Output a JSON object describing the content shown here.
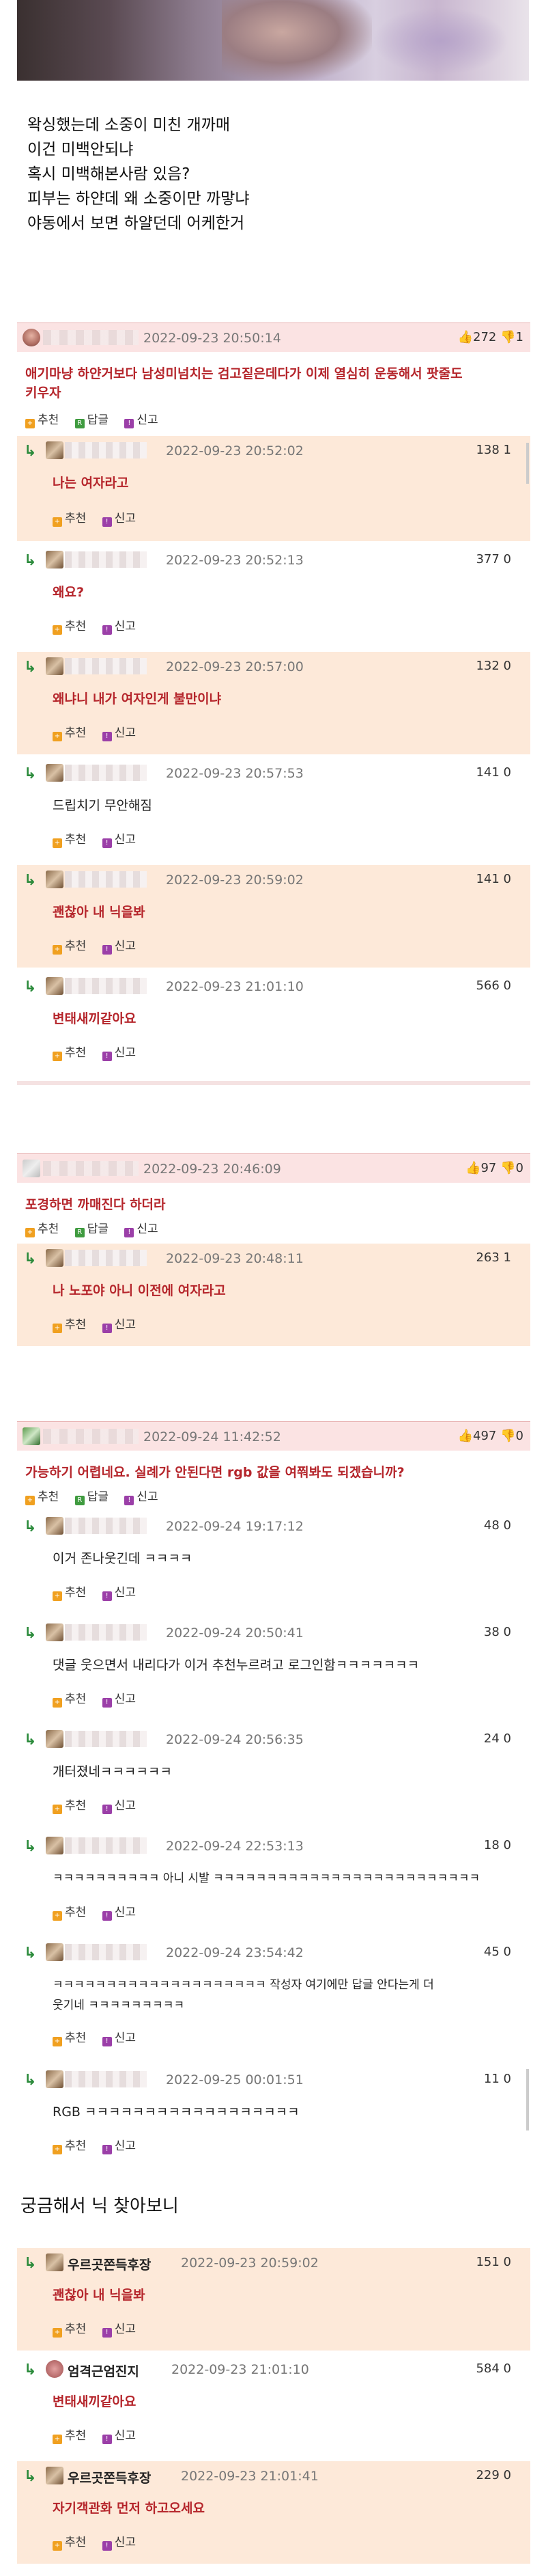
{
  "post": {
    "lines": [
      "왁싱했는데 소중이 미친 개까매",
      "이건 미백안되냐",
      "혹시 미백해본사람 있음?",
      "피부는 하얀데 왜 소중이만 까맣냐",
      "야동에서 보면 하얄던데 어케한거"
    ]
  },
  "actions": {
    "recommend": "추천",
    "reply": "답글",
    "report": "신고"
  },
  "thread1": {
    "date": "2022-09-23 20:50:14",
    "up": "272",
    "down": "1",
    "text1": "애기마냥 하얀거보다 남성미넘치는 검고짙은데다가 이제 열심히 운동해서 팟줄도",
    "text2": "키우자",
    "replies": [
      {
        "date": "2022-09-23 20:52:02",
        "up": "138",
        "down": "1",
        "text": "나는 여자라고"
      },
      {
        "date": "2022-09-23 20:52:13",
        "up": "377",
        "down": "0",
        "text": "왜요?"
      },
      {
        "date": "2022-09-23 20:57:00",
        "up": "132",
        "down": "0",
        "text": "왜냐니 내가 여자인게 불만이냐"
      },
      {
        "date": "2022-09-23 20:57:53",
        "up": "141",
        "down": "0",
        "text": "드립치기 무안해짐"
      },
      {
        "date": "2022-09-23 20:59:02",
        "up": "141",
        "down": "0",
        "text": "괜찮아 내 닉을봐"
      },
      {
        "date": "2022-09-23 21:01:10",
        "up": "566",
        "down": "0",
        "text": "변태새끼같아요"
      }
    ]
  },
  "thread2": {
    "date": "2022-09-23 20:46:09",
    "up": "97",
    "down": "0",
    "text": "포경하면 까매진다 하더라",
    "reply": {
      "date": "2022-09-23 20:48:11",
      "up": "263",
      "down": "1",
      "text": "나 노포야 아니 이전에 여자라고"
    }
  },
  "thread3": {
    "date": "2022-09-24 11:42:52",
    "up": "497",
    "down": "0",
    "text": "가능하기 어렵네요. 실례가 안된다면 rgb 값을 여쭤봐도 되겠습니까?",
    "replies": [
      {
        "date": "2022-09-24 19:17:12",
        "up": "48",
        "down": "0",
        "text": "이거 존나웃긴데 ㅋㅋㅋㅋ"
      },
      {
        "date": "2022-09-24 20:50:41",
        "up": "38",
        "down": "0",
        "text": "댓글 웃으면서 내리다가 이거 추천누르려고 로그인함ㅋㅋㅋㅋㅋㅋㅋ"
      },
      {
        "date": "2022-09-24 20:56:35",
        "up": "24",
        "down": "0",
        "text": "개터졌네ㅋㅋㅋㅋㅋㅋ"
      },
      {
        "date": "2022-09-24 22:53:13",
        "up": "18",
        "down": "0",
        "text": "ㅋㅋㅋㅋㅋㅋㅋㅋㅋㅋ 아니 시발 ㅋㅋㅋㅋㅋㅋㅋㅋㅋㅋㅋㅋㅋㅋㅋㅋㅋㅋㅋㅋㅋㅋㅋㅋㅋ"
      },
      {
        "date": "2022-09-24 23:54:42",
        "up": "45",
        "down": "0",
        "text": "ㅋㅋㅋㅋㅋㅋㅋㅋㅋㅋㅋㅋㅋㅋㅋㅋㅋㅋㅋㅋ 작성자 여기에만 답글 안다는게 더",
        "text2": "웃기네 ㅋㅋㅋㅋㅋㅋㅋㅋㅋ"
      },
      {
        "date": "2022-09-25 00:01:51",
        "up": "11",
        "down": "0",
        "text": "RGB ㅋㅋㅋㅋㅋㅋㅋㅋㅋㅋㅋㅋㅋㅋㅋㅋㅋㅋ"
      }
    ]
  },
  "section2": {
    "heading": "궁금해서 닉 찾아보니",
    "replies": [
      {
        "nick": "우르곳쫀득후장",
        "date": "2022-09-23 20:59:02",
        "up": "151",
        "down": "0",
        "text": "괜찮아 내 닉을봐"
      },
      {
        "nick": "엄격근엄진지",
        "date": "2022-09-23 21:01:10",
        "up": "584",
        "down": "0",
        "text": "변태새끼같아요"
      },
      {
        "nick": "우르곳쫀득후장",
        "date": "2022-09-23 21:01:41",
        "up": "229",
        "down": "0",
        "text": "자기객관화 먼저 하고오세요"
      }
    ]
  }
}
